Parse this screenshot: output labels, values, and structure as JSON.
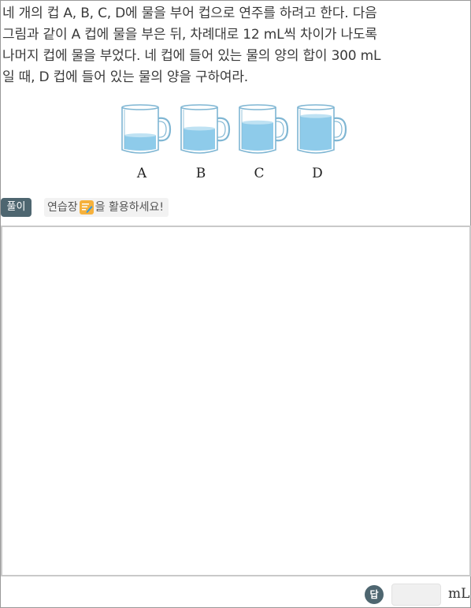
{
  "question": {
    "lines": [
      "네 개의 컵 A, B, C, D에 물을 부어 컵으로 연주를 하려고 한다. 다음",
      "그림과 같이 A 컵에 물을 부은 뒤, 차례대로 12 mL씩 차이가 나도록",
      "나머지 컵에 물을 부었다. 네 컵에 들어 있는 물의 양의 합이 300 mL",
      "일 때, D 컵에 들어 있는 물의 양을 구하여라."
    ]
  },
  "figure": {
    "cups": [
      {
        "label": "A",
        "fill_level": 0.38
      },
      {
        "label": "B",
        "fill_level": 0.55
      },
      {
        "label": "C",
        "fill_level": 0.7
      },
      {
        "label": "D",
        "fill_level": 0.86
      }
    ],
    "colors": {
      "water": "#8ecbea",
      "glass": "#7fb6d3"
    }
  },
  "tools": {
    "solve_label": "풀이",
    "hint_prefix": "연습장",
    "hint_icon": "note-pencil-icon",
    "hint_suffix": "을 활용하세요!"
  },
  "answer": {
    "badge_label": "답",
    "value": "",
    "unit": "mL"
  }
}
